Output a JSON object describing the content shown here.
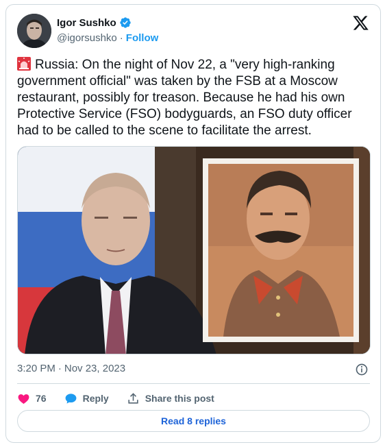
{
  "author": {
    "display_name": "Igor Sushko",
    "handle": "@igorsushko",
    "separator": "·",
    "follow_label": "Follow",
    "verified": true
  },
  "tweet": {
    "text": "Russia: On the night of Nov 22, a \"very high-ranking government official\" was taken by the FSB at a Moscow restaurant, possibly for treason. Because he had his own Protective Service (FSO) bodyguards, an FSO duty officer had to be called to the scene to facilitate the arrest.",
    "time": "3:20 PM",
    "date_separator": "·",
    "date": "Nov 23, 2023"
  },
  "actions": {
    "like_count": "76",
    "reply_label": "Reply",
    "share_label": "Share this post"
  },
  "read_replies_label": "Read 8 replies",
  "icons": {
    "logo": "x-logo-icon",
    "verified": "verified-badge-icon",
    "siren": "rotating-light-emoji-icon",
    "info": "info-icon",
    "like": "heart-icon",
    "reply": "speech-bubble-icon",
    "share": "share-upload-icon"
  },
  "colors": {
    "accent": "#1d9bf0",
    "link": "#1d63d8",
    "like": "#f91880",
    "text": "#0f1419",
    "secondary": "#536471",
    "border": "#cfd9de"
  }
}
